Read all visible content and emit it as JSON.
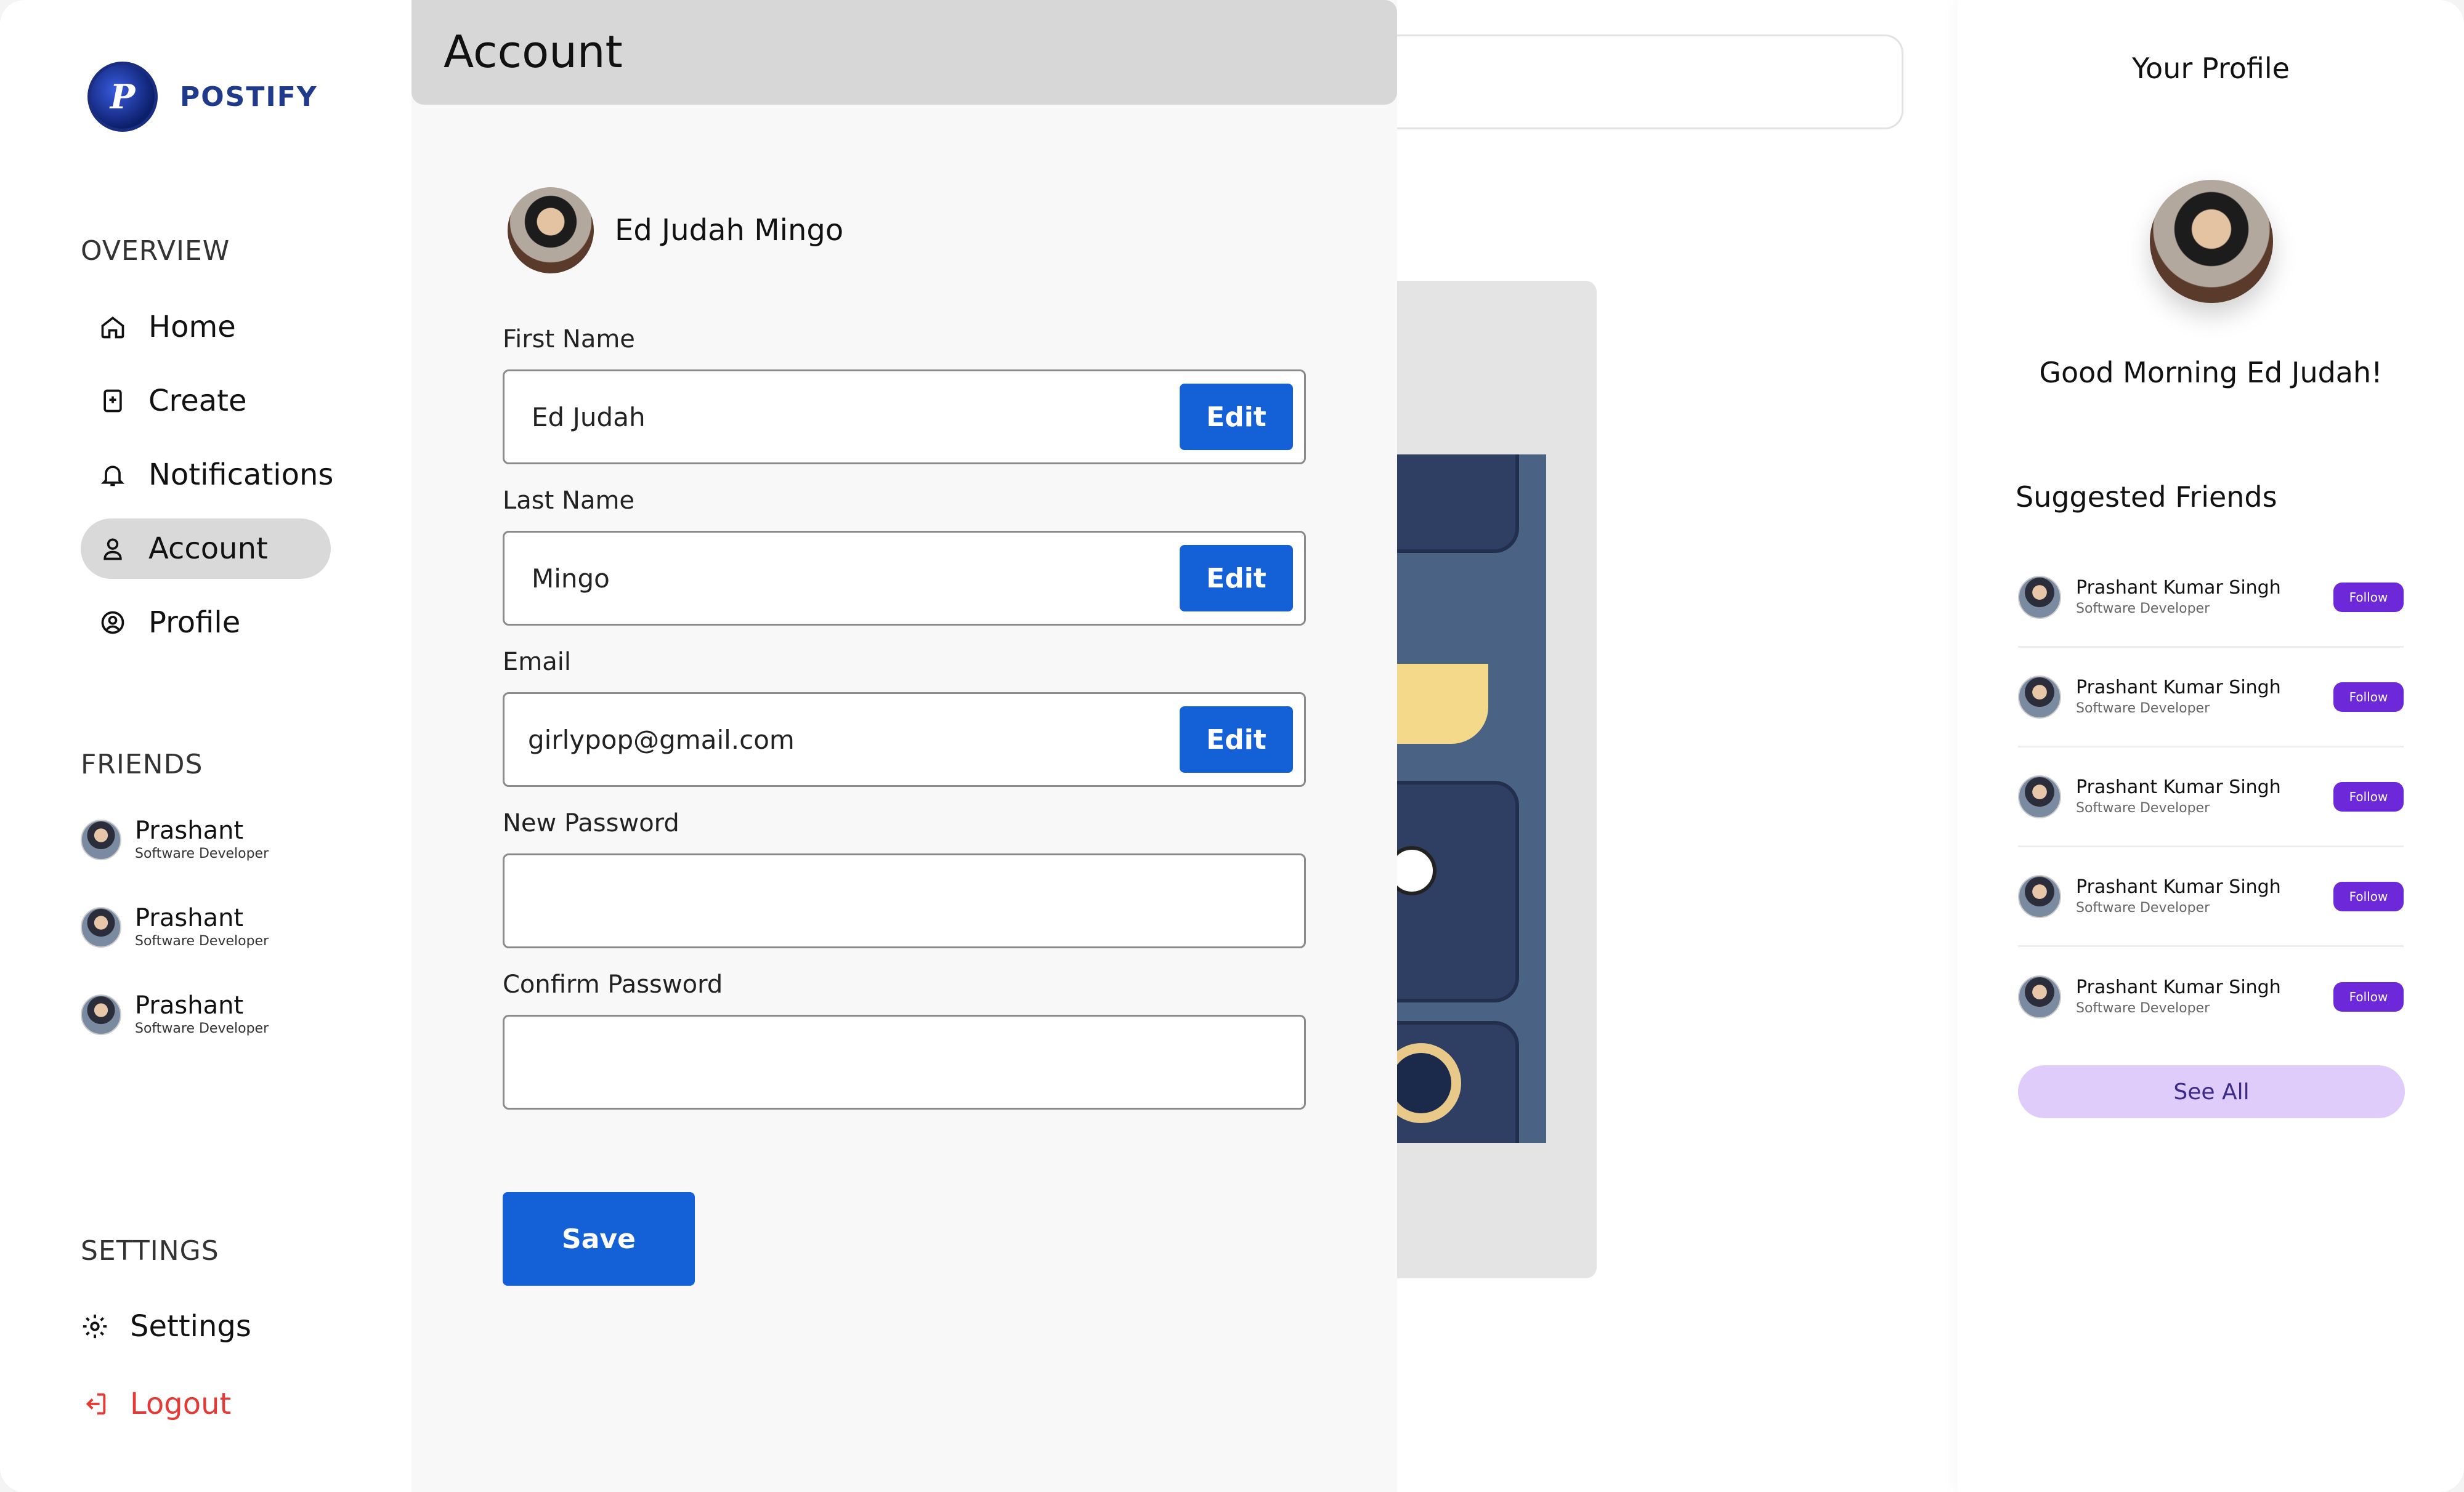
{
  "brand": {
    "name": "POSTIFY",
    "logo_letter": "P"
  },
  "sidebar": {
    "overview_title": "OVERVIEW",
    "items": [
      {
        "label": "Home",
        "icon": "home-icon"
      },
      {
        "label": "Create",
        "icon": "create-icon"
      },
      {
        "label": "Notifications",
        "icon": "bell-icon"
      },
      {
        "label": "Account",
        "icon": "user-icon"
      },
      {
        "label": "Profile",
        "icon": "profile-circle-icon"
      }
    ],
    "friends_title": "FRIENDS",
    "friends": [
      {
        "name": "Prashant",
        "role": "Software Developer"
      },
      {
        "name": "Prashant",
        "role": "Software Developer"
      },
      {
        "name": "Prashant",
        "role": "Software Developer"
      }
    ],
    "settings_title": "SETTINGS",
    "settings_label": "Settings",
    "logout_label": "Logout"
  },
  "account": {
    "title": "Account",
    "user_name": "Ed Judah Mingo",
    "fields": [
      {
        "label": "First Name",
        "value": "Ed Judah",
        "button": "Edit"
      },
      {
        "label": "Last Name",
        "value": "Mingo",
        "button": "Edit"
      },
      {
        "label": "Email",
        "value": "girlypop@gmail.com",
        "button": "Edit"
      },
      {
        "label": "New Password",
        "value": ""
      },
      {
        "label": "Confirm Password",
        "value": ""
      }
    ],
    "save_label": "Save"
  },
  "right_panel": {
    "title": "Your Profile",
    "greeting": "Good Morning Ed Judah!",
    "suggested_title": "Suggested Friends",
    "suggested": [
      {
        "name": "Prashant Kumar Singh",
        "role": "Software Developer",
        "button": "Follow"
      },
      {
        "name": "Prashant Kumar Singh",
        "role": "Software Developer",
        "button": "Follow"
      },
      {
        "name": "Prashant Kumar Singh",
        "role": "Software Developer",
        "button": "Follow"
      },
      {
        "name": "Prashant Kumar Singh",
        "role": "Software Developer",
        "button": "Follow"
      },
      {
        "name": "Prashant Kumar Singh",
        "role": "Software Developer",
        "button": "Follow"
      }
    ],
    "see_all_label": "See All"
  },
  "colors": {
    "brand": "#1f3a8a",
    "primary_button": "#1460d6",
    "follow_button": "#6d28d9",
    "see_all_bg": "#e0ccfb",
    "logout": "#e53935",
    "active_nav": "#d9d9d9"
  }
}
